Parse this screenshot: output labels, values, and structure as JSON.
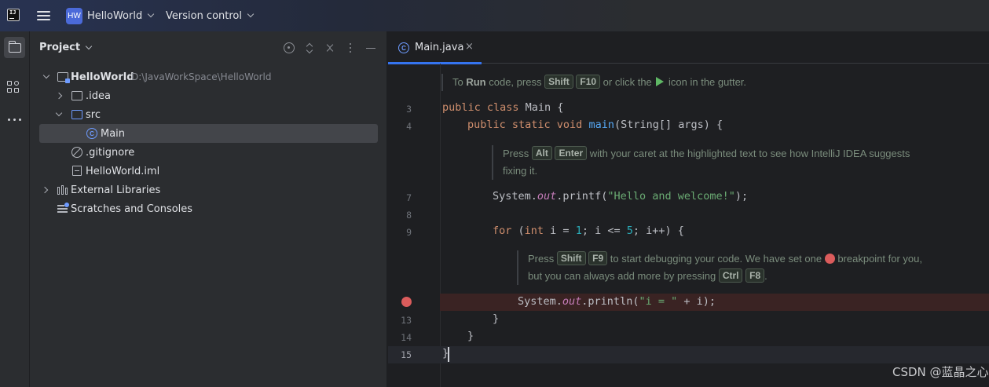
{
  "titlebar": {
    "logo_text": "IJ",
    "project_badge": "HW",
    "project_name": "HelloWorld",
    "version_control": "Version control"
  },
  "toolstrip": {
    "icons": [
      "project-folder-icon",
      "structure-icon",
      "more-icon"
    ]
  },
  "project_panel": {
    "title": "Project",
    "header_icons": [
      "locate-icon",
      "expand-all-icon",
      "collapse-all-icon",
      "options-icon",
      "hide-icon"
    ],
    "tree": [
      {
        "label": "HelloWorld",
        "path": "D:\\JavaWorkSpace\\HelloWorld",
        "icon": "module-folder-icon",
        "expanded": true
      },
      {
        "label": ".idea",
        "icon": "folder-icon",
        "expanded": false
      },
      {
        "label": "src",
        "icon": "source-folder-icon",
        "expanded": true
      },
      {
        "label": "Main",
        "icon": "java-class-icon",
        "selected": true
      },
      {
        "label": ".gitignore",
        "icon": "gitignore-icon"
      },
      {
        "label": "HelloWorld.iml",
        "icon": "iml-file-icon"
      },
      {
        "label": "External Libraries",
        "icon": "library-icon",
        "expanded": false
      },
      {
        "label": "Scratches and Consoles",
        "icon": "scratches-icon"
      }
    ]
  },
  "editor": {
    "tab": {
      "label": "Main.java",
      "icon": "java-class-icon",
      "close": "×"
    },
    "hint_run": {
      "pre": "To ",
      "bold": "Run",
      "mid": " code, press ",
      "k1": "Shift",
      "k2": "F10",
      "post": " or click the ",
      "post2": " icon in the gutter."
    },
    "hint_alt": {
      "pre": "Press ",
      "k1": "Alt",
      "k2": "Enter",
      "post": " with your caret at the highlighted text to see how IntelliJ IDEA suggests",
      "line2": "fixing it."
    },
    "hint_debug": {
      "pre": "Press ",
      "k1": "Shift",
      "k2": "F9",
      "post": " to start debugging your code. We have set one ",
      "post2": " breakpoint for you,",
      "line2": "but you can always add more by pressing ",
      "k3": "Ctrl",
      "k4": "F8",
      "end": "."
    },
    "line_numbers": [
      "3",
      "4",
      "7",
      "8",
      "9",
      "13",
      "14",
      "15"
    ],
    "code": {
      "l3_kw": "public class ",
      "l3_name": "Main {",
      "l4_kw": "public static void ",
      "l4_fn": "main",
      "l4_rest": "(String[] args) {",
      "l7_a": "System.",
      "l7_out": "out",
      "l7_b": ".printf(",
      "l7_str": "\"Hello and welcome!\"",
      "l7_c": ");",
      "l9_kw": "for ",
      "l9_a": "(",
      "l9_int": "int",
      "l9_b": " i = ",
      "l9_n1": "1",
      "l9_c": "; i <= ",
      "l9_n2": "5",
      "l9_d": "; i++) {",
      "l12_a": "System.",
      "l12_out": "out",
      "l12_b": ".println(",
      "l12_str": "\"i = \"",
      "l12_c": " + i);",
      "l13": "}",
      "l14": "}",
      "l15": "}"
    }
  },
  "watermark": "CSDN @蓝晶之心",
  "colors": {
    "accent": "#3574f0",
    "breakpoint": "#db5c5c",
    "keyword": "#cf8e6d",
    "function": "#56a8f5",
    "string": "#6aab73"
  }
}
